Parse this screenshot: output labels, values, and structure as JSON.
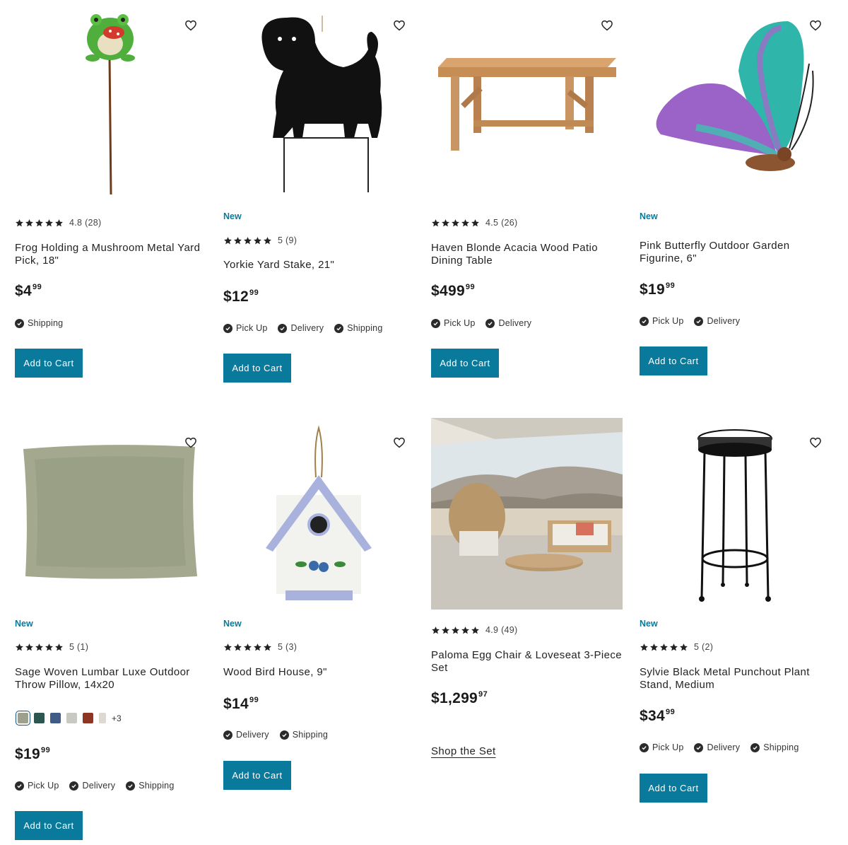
{
  "colors": {
    "accent": "#0a7a9c",
    "badge": "#0a7a9c"
  },
  "products": [
    {
      "image": "frog-yard-pick-image",
      "badge": "",
      "rating": "4.8",
      "reviews": "(28)",
      "title_line1": "Frog Holding a Mushroom Metal Yard",
      "title_line2": "Pick, 18\"",
      "price_dollars": "$4",
      "price_cents": "99",
      "fulfillment": [
        "Shipping"
      ],
      "cta": "Add to Cart"
    },
    {
      "image": "yorkie-yard-stake-image",
      "badge": "New",
      "rating": "5",
      "reviews": "(9)",
      "title_line1": "Yorkie Yard Stake, 21\"",
      "title_line2": "",
      "price_dollars": "$12",
      "price_cents": "99",
      "fulfillment": [
        "Pick Up",
        "Delivery",
        "Shipping"
      ],
      "cta": "Add to Cart"
    },
    {
      "image": "acacia-dining-table-image",
      "badge": "",
      "rating": "4.5",
      "reviews": "(26)",
      "title_line1": "Haven Blonde Acacia Wood Patio",
      "title_line2": "Dining Table",
      "price_dollars": "$499",
      "price_cents": "99",
      "fulfillment": [
        "Pick Up",
        "Delivery"
      ],
      "cta": "Add to Cart"
    },
    {
      "image": "butterfly-figurine-image",
      "badge": "New",
      "rating": "",
      "reviews": "",
      "title_line1": "Pink Butterfly Outdoor Garden",
      "title_line2": "Figurine, 6\"",
      "price_dollars": "$19",
      "price_cents": "99",
      "fulfillment": [
        "Pick Up",
        "Delivery"
      ],
      "cta": "Add to Cart"
    },
    {
      "image": "lumbar-pillow-image",
      "badge": "New",
      "rating": "5",
      "reviews": "(1)",
      "title_line1": "Sage Woven Lumbar Luxe Outdoor",
      "title_line2": "Throw Pillow, 14x20",
      "swatches": [
        "#9da08c",
        "#2e5650",
        "#3f5b86",
        "#c9c9c3",
        "#8f3524",
        "#dcd9d1"
      ],
      "swatch_more": "+3",
      "price_dollars": "$19",
      "price_cents": "99",
      "fulfillment": [
        "Pick Up",
        "Delivery",
        "Shipping"
      ],
      "cta": "Add to Cart"
    },
    {
      "image": "bird-house-image",
      "badge": "New",
      "rating": "5",
      "reviews": "(3)",
      "title_line1": "Wood Bird House, 9\"",
      "title_line2": "",
      "price_dollars": "$14",
      "price_cents": "99",
      "fulfillment": [
        "Delivery",
        "Shipping"
      ],
      "cta": "Add to Cart"
    },
    {
      "image": "egg-chair-set-image",
      "badge": "",
      "rating": "4.9",
      "reviews": "(49)",
      "title_line1": "Paloma Egg Chair & Loveseat 3-Piece",
      "title_line2": "Set",
      "price_dollars": "$1,299",
      "price_cents": "97",
      "link": "Shop the Set"
    },
    {
      "image": "plant-stand-image",
      "badge": "New",
      "rating": "5",
      "reviews": "(2)",
      "title_line1": "Sylvie Black Metal Punchout Plant",
      "title_line2": "Stand, Medium",
      "price_dollars": "$34",
      "price_cents": "99",
      "fulfillment": [
        "Pick Up",
        "Delivery",
        "Shipping"
      ],
      "cta": "Add to Cart"
    }
  ]
}
